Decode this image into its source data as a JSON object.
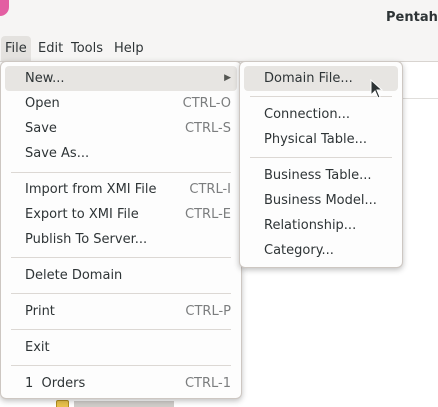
{
  "window": {
    "title": "Pentaho"
  },
  "menubar": {
    "items": [
      "File",
      "Edit",
      "Tools",
      "Help"
    ]
  },
  "file_menu": {
    "new": "New...",
    "open": {
      "label": "Open",
      "shortcut": "CTRL-O"
    },
    "save": {
      "label": "Save",
      "shortcut": "CTRL-S"
    },
    "save_as": "Save As...",
    "import_xmi": {
      "label": "Import from XMI File",
      "shortcut": "CTRL-I"
    },
    "export_xmi": {
      "label": "Export to XMI File",
      "shortcut": "CTRL-E"
    },
    "publish": "Publish To Server...",
    "delete_domain": "Delete Domain",
    "print": {
      "label": "Print",
      "shortcut": "CTRL-P"
    },
    "exit": "Exit",
    "recent": {
      "label": "1  Orders",
      "shortcut": "CTRL-1"
    }
  },
  "new_submenu": {
    "domain_file": "Domain File...",
    "connection": "Connection...",
    "physical_table": "Physical Table...",
    "business_table": "Business Table...",
    "business_model": "Business Model...",
    "relationship": "Relationship...",
    "category": "Category..."
  },
  "colors": {
    "menu_highlight": "#e7e5e2",
    "accent_corner": "#e35fa2"
  }
}
